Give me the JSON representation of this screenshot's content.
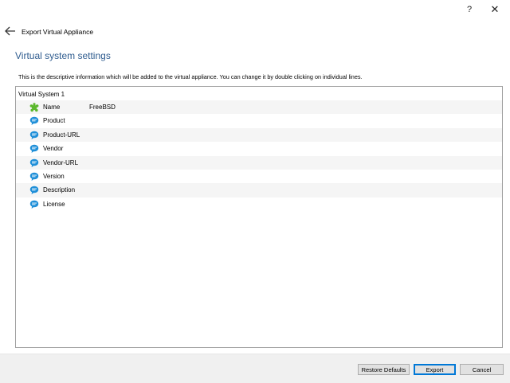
{
  "window": {
    "help_glyph": "?",
    "close_glyph": "✕"
  },
  "wizard": {
    "title": "Export Virtual Appliance"
  },
  "page": {
    "title": "Virtual system settings",
    "description": "This is the descriptive information which will be added to the virtual appliance. You can change it by double clicking on individual lines."
  },
  "tree": {
    "root": "Virtual System 1",
    "rows": [
      {
        "label": "Name",
        "value": "FreeBSD",
        "icon": "name-icon"
      },
      {
        "label": "Product",
        "value": "",
        "icon": "description-icon"
      },
      {
        "label": "Product-URL",
        "value": "",
        "icon": "description-icon"
      },
      {
        "label": "Vendor",
        "value": "",
        "icon": "description-icon"
      },
      {
        "label": "Vendor-URL",
        "value": "",
        "icon": "description-icon"
      },
      {
        "label": "Version",
        "value": "",
        "icon": "description-icon"
      },
      {
        "label": "Description",
        "value": "",
        "icon": "description-icon"
      },
      {
        "label": "License",
        "value": "",
        "icon": "description-icon"
      }
    ]
  },
  "buttons": {
    "restore": "Restore Defaults",
    "export": "Export",
    "cancel": "Cancel"
  },
  "colors": {
    "title": "#2f5c8f",
    "icon_blue": "#1f8fd8",
    "icon_green": "#5cb82d"
  }
}
